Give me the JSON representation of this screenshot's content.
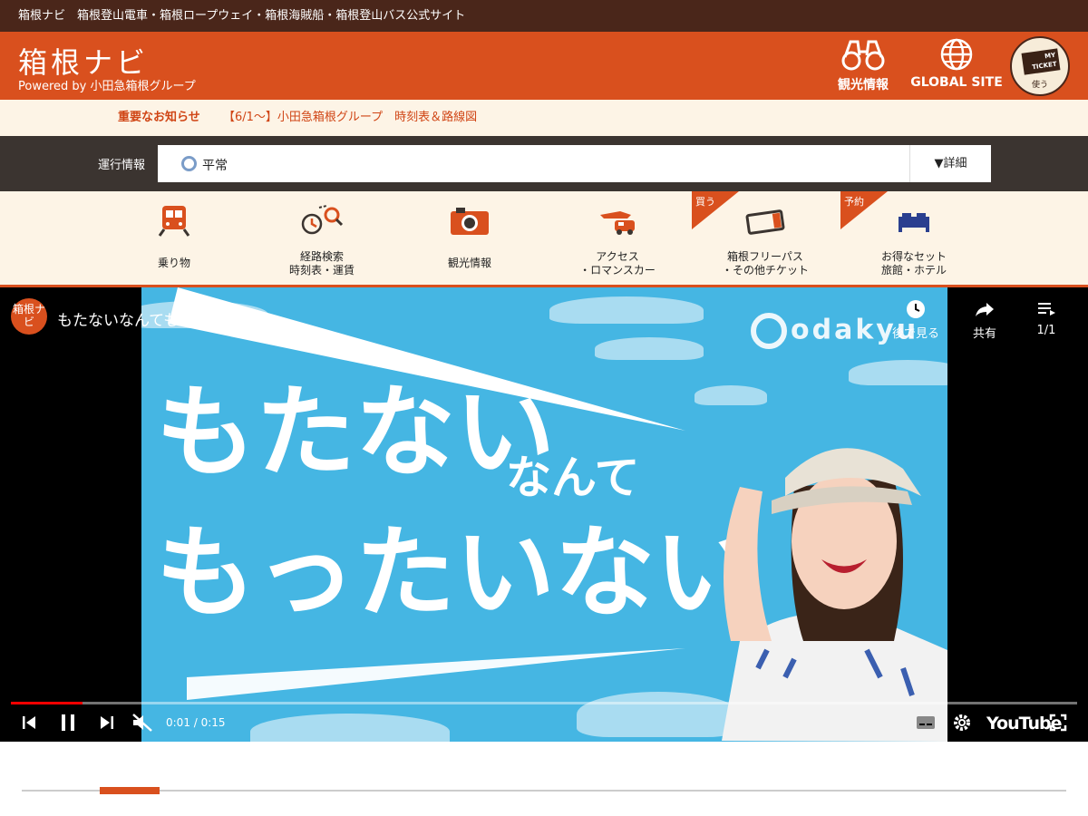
{
  "topbar": {
    "text": "箱根ナビ　箱根登山電車・箱根ロープウェイ・箱根海賊船・箱根登山バス公式サイト"
  },
  "header": {
    "logo_title": "箱根ナビ",
    "logo_sub": "Powered by 小田急箱根グループ",
    "sightseeing_label": "観光情報",
    "global_label": "GLOBAL SITE",
    "myticket_label": "MY TICKET",
    "myticket_use": "使う"
  },
  "notice": {
    "label": "重要なお知らせ",
    "link": "【6/1〜】小田急箱根グループ　時刻表＆路線図"
  },
  "operation": {
    "label": "運行情報",
    "status": "平常",
    "detail": "▼詳細"
  },
  "nav": {
    "items": [
      {
        "line1": "乗り物",
        "line2": "",
        "icon": "train-icon"
      },
      {
        "line1": "経路検索",
        "line2": "時刻表・運賃",
        "icon": "route-search-icon"
      },
      {
        "line1": "観光情報",
        "line2": "",
        "icon": "camera-icon"
      },
      {
        "line1": "アクセス",
        "line2": "・ロマンスカー",
        "icon": "romancecar-icon"
      },
      {
        "line1": "箱根フリーパス",
        "line2": "・その他チケット",
        "icon": "ticket-icon",
        "ribbon": "買う"
      },
      {
        "line1": "お得なセット",
        "line2": "旅館・ホテル",
        "icon": "bed-icon",
        "ribbon": "予約"
      }
    ]
  },
  "video": {
    "channel_avatar": "箱根ナビ",
    "title": "もたないなんてもったいない",
    "watch_later": "後で見る",
    "share": "共有",
    "playlist": "1/1",
    "brand": "odakyu",
    "overlay_line1": "もたない",
    "overlay_small": "なんて",
    "overlay_line2": "もったいない",
    "time": "0:01 / 0:15",
    "progress_fraction": 0.067,
    "youtube": "YouTube"
  },
  "colors": {
    "brand_orange": "#d9501e",
    "dark_brown": "#4a261a",
    "cream": "#fdf4e6",
    "sky": "#45b6e3"
  }
}
